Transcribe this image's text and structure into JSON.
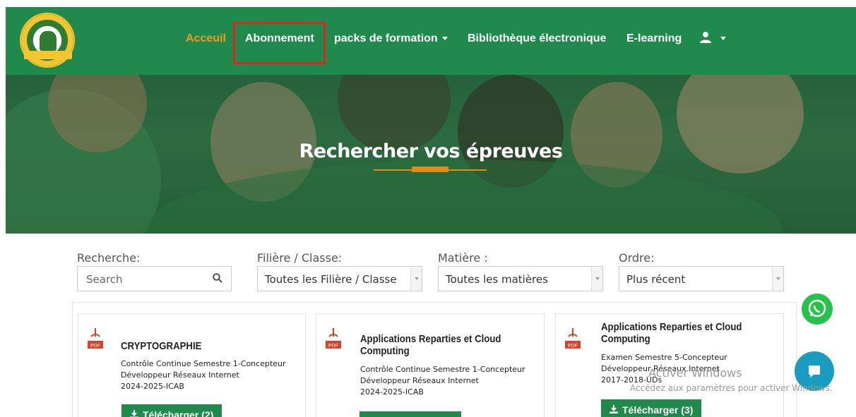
{
  "nav": {
    "items": [
      {
        "label": "Acceuil",
        "active": true
      },
      {
        "label": "Abonnement",
        "active": false
      },
      {
        "label": "packs de formation",
        "active": false,
        "dropdown": true
      },
      {
        "label": "Bibliothèque électronique",
        "active": false
      },
      {
        "label": "E-learning",
        "active": false
      }
    ],
    "user_menu_icon": "user-icon",
    "brand_color": "#1f8a4c",
    "active_color": "#f29a1d",
    "highlight_color": "#e02424"
  },
  "hero": {
    "title": "Rechercher vos épreuves",
    "accent_color": "#e08a1a"
  },
  "filters": {
    "search_label": "Recherche:",
    "search_placeholder": "Search",
    "filiere_label": "Filière / Classe:",
    "filiere_value": "Toutes les Filière / Classe",
    "matiere_label": "Matière :",
    "matiere_value": "Toutes les matières",
    "ordre_label": "Ordre:",
    "ordre_value": "Plus récent"
  },
  "cards": [
    {
      "title": "CRYPTOGRAPHIE",
      "desc_lines": [
        "Contrôle Continue Semestre 1-Concepteur",
        "Développeur Réseaux Internet",
        "2024-2025-ICAB"
      ],
      "button": "Télécharger (2)"
    },
    {
      "title_lines": [
        "Applications Reparties et Cloud",
        "Computing"
      ],
      "desc_lines": [
        "Contrôle Continue Semestre 1-Concepteur",
        "Développeur Réseaux Internet",
        "2024-2025-ICAB"
      ],
      "button": ""
    },
    {
      "title_lines": [
        "Applications Reparties et Cloud",
        "Computing"
      ],
      "desc_lines": [
        "Examen Semestre 5-Concepteur",
        "Développeur Réseaux Internet",
        "2017-2018-UDs"
      ],
      "button": "Télécharger (3)"
    }
  ],
  "windows_watermark": {
    "line1": "Activer Windows",
    "line2": "Accédez aux paramètres pour activer Windows."
  }
}
